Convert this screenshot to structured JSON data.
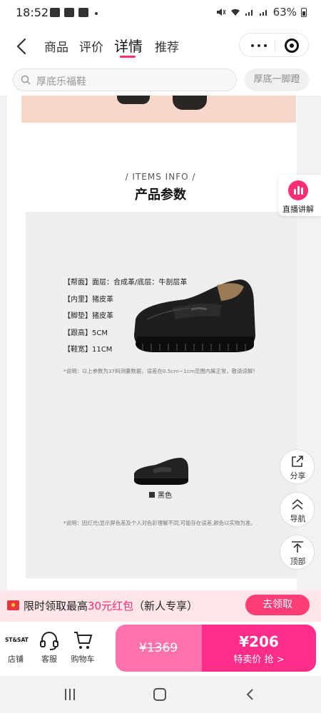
{
  "status_bar": {
    "time": "18:52",
    "battery": "63%"
  },
  "nav": {
    "tabs": [
      {
        "label": "商品"
      },
      {
        "label": "评价"
      },
      {
        "label": "详情"
      },
      {
        "label": "推荐"
      }
    ],
    "active_tab": "详情"
  },
  "search": {
    "placeholder": "厚底乐福鞋",
    "chip": "厚底一脚蹬"
  },
  "section": {
    "subtitle": "/  ITEMS INFO  /",
    "title": "产品参数"
  },
  "specs": [
    "【帮面】面层：合成革/底层：牛剖层革",
    "【内里】猪皮革",
    "【脚垫】猪皮革",
    "【跟高】5CM",
    "【鞋宽】11CM"
  ],
  "notes": {
    "measure": "*说明：以上参数为37码测量数据，误差在0.5cm~1cm范围内属正常，敬请谅解！",
    "color": "*说明：因灯光\\显示屏色差及个人对色彩理解不同,可能存在误差,颜色以实物为准。"
  },
  "color_option": "黑色",
  "live": {
    "label": "直播讲解"
  },
  "float_buttons": {
    "share": "分享",
    "guide": "导航",
    "top": "顶部"
  },
  "promo": {
    "prefix": "限时领取最高",
    "highlight": "30元红包",
    "suffix": "（新人专享）",
    "claim": "去领取"
  },
  "bottom_bar": {
    "store_logo": "ST&SAT",
    "store": "店铺",
    "service": "客服",
    "cart": "购物车",
    "original_price": "¥1369",
    "sale_price": "¥206",
    "sale_label": "特卖价 抢 >"
  },
  "colors": {
    "accent": "#ff2d6a",
    "price_left": "#ff72ac",
    "price_right": "#ff2d8a"
  }
}
